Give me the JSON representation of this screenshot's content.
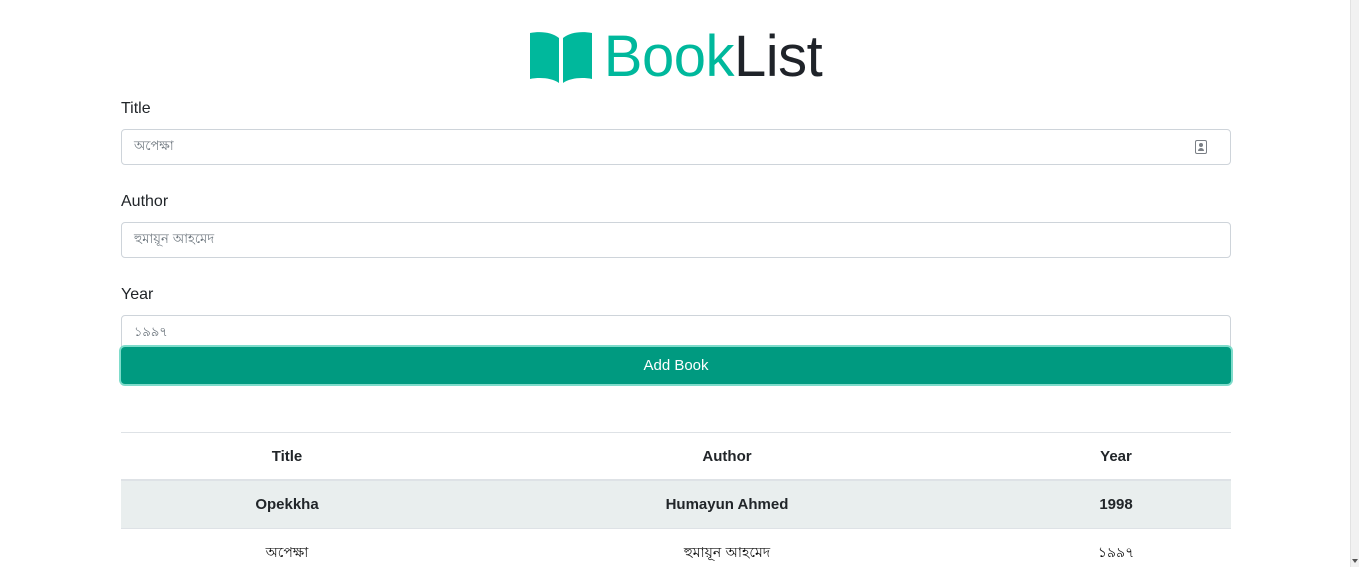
{
  "brand": {
    "part1": "Book",
    "part2": "List",
    "icon": "open-book-icon",
    "accent_color": "#00b89c"
  },
  "form": {
    "title_label": "Title",
    "title_placeholder": "অপেক্ষা",
    "author_label": "Author",
    "author_placeholder": "হুমায়ূন আহমেদ",
    "year_label": "Year",
    "year_placeholder": "১৯৯৭",
    "submit_label": "Add Book",
    "submit_color": "#009a80"
  },
  "table": {
    "headers": [
      "Title",
      "Author",
      "Year"
    ],
    "rows": [
      [
        "Opekkha",
        "Humayun Ahmed",
        "1998"
      ],
      [
        "অপেক্ষা",
        "হুমায়ূন আহমেদ",
        "১৯৯৭"
      ]
    ]
  }
}
